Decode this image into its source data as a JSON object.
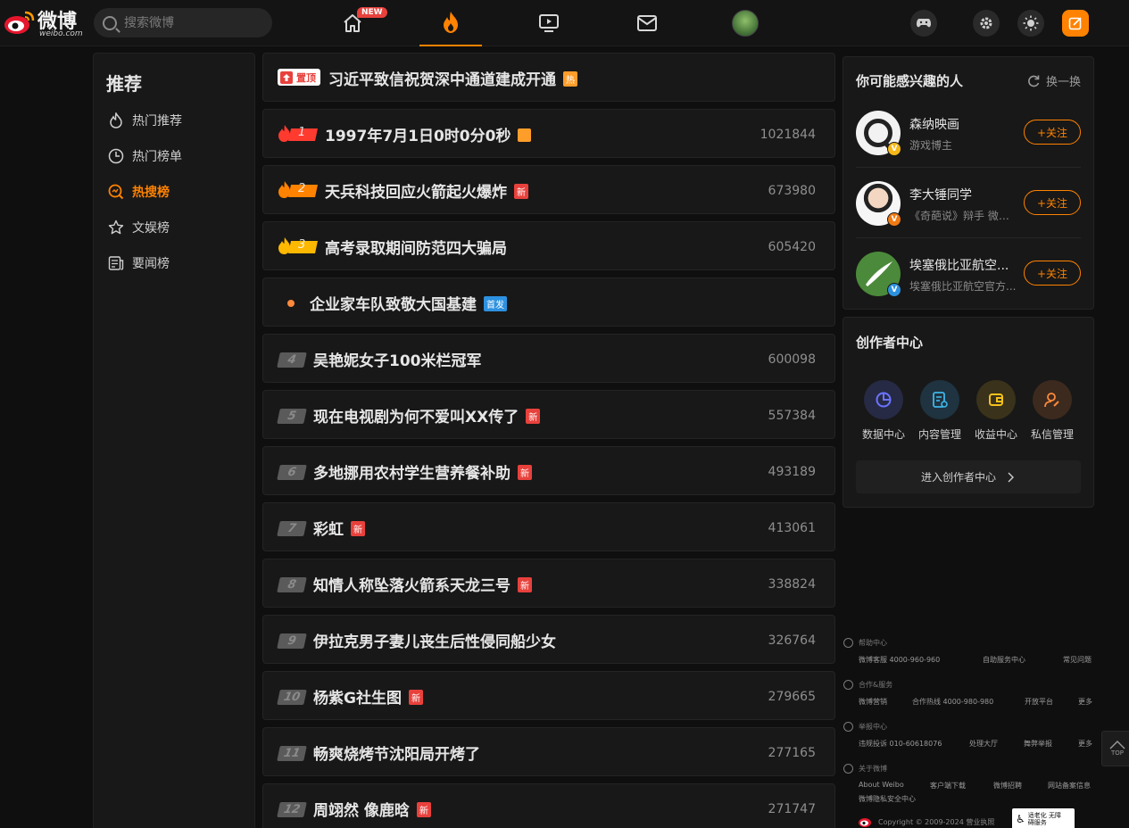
{
  "header": {
    "logo_text": "微博",
    "logo_sub": "weibo.com",
    "search_placeholder": "搜索微博",
    "new_badge": "NEW"
  },
  "sidebar": {
    "title": "推荐",
    "items": [
      {
        "label": "热门推荐",
        "icon": "flame-icon"
      },
      {
        "label": "热门榜单",
        "icon": "clock-icon"
      },
      {
        "label": "热搜榜",
        "icon": "search-trend-icon",
        "active": true
      },
      {
        "label": "文娱榜",
        "icon": "star-icon"
      },
      {
        "label": "要闻榜",
        "icon": "news-icon"
      }
    ]
  },
  "hot_list": {
    "pinned": {
      "pin_label": "置顶",
      "title": "习近平致信祝贺深中通道建成开通",
      "tag": "热"
    },
    "items": [
      {
        "rank": "1",
        "title": "1997年7月1日0时0分0秒",
        "tag": "",
        "tag_type": "hot-orange",
        "count": "1021844"
      },
      {
        "rank": "2",
        "title": "天兵科技回应火箭起火爆炸",
        "tag": "新",
        "tag_type": "new",
        "count": "673980"
      },
      {
        "rank": "3",
        "title": "高考录取期间防范四大骗局",
        "tag": "",
        "tag_type": "",
        "count": "605420"
      },
      {
        "rank": "",
        "title": "企业家车队致敬大国基建",
        "tag": "首发",
        "tag_type": "first",
        "count": ""
      },
      {
        "rank": "4",
        "title": "吴艳妮女子100米栏冠军",
        "tag": "",
        "tag_type": "",
        "count": "600098"
      },
      {
        "rank": "5",
        "title": "现在电视剧为何不爱叫XX传了",
        "tag": "新",
        "tag_type": "new",
        "count": "557384"
      },
      {
        "rank": "6",
        "title": "多地挪用农村学生营养餐补助",
        "tag": "新",
        "tag_type": "new",
        "count": "493189"
      },
      {
        "rank": "7",
        "title": "彩虹",
        "tag": "新",
        "tag_type": "new",
        "count": "413061"
      },
      {
        "rank": "8",
        "title": "知情人称坠落火箭系天龙三号",
        "tag": "新",
        "tag_type": "new",
        "count": "338824"
      },
      {
        "rank": "9",
        "title": "伊拉克男子妻儿丧生后性侵同船少女",
        "tag": "",
        "tag_type": "",
        "count": "326764"
      },
      {
        "rank": "10",
        "title": "杨紫G社生图",
        "tag": "新",
        "tag_type": "new",
        "count": "279665"
      },
      {
        "rank": "11",
        "title": "畅爽烧烤节沈阳局开烤了",
        "tag": "",
        "tag_type": "",
        "count": "277165"
      },
      {
        "rank": "12",
        "title": "周翊然 像鹿晗",
        "tag": "新",
        "tag_type": "new",
        "count": "271747"
      }
    ]
  },
  "suggest": {
    "title": "你可能感兴趣的人",
    "refresh_label": "换一换",
    "follow_label": "+关注",
    "people": [
      {
        "name": "森纳映画",
        "desc": "游戏博主",
        "badge": "V",
        "badge_color": "#f5b819"
      },
      {
        "name": "李大锤同学",
        "desc": "《奇葩说》辩手 微博...",
        "badge": "V",
        "badge_color": "#f07b14"
      },
      {
        "name": "埃塞俄比亚航空...",
        "desc": "埃塞俄比亚航空官方...",
        "badge": "V",
        "badge_color": "#2d91e0"
      }
    ]
  },
  "creator": {
    "title": "创作者中心",
    "items": [
      {
        "label": "数据中心",
        "icon": "pie-chart-icon",
        "color": "#6b74ff",
        "bg": "#262a44"
      },
      {
        "label": "内容管理",
        "icon": "document-edit-icon",
        "color": "#3fb6e8",
        "bg": "#1f3340"
      },
      {
        "label": "收益中心",
        "icon": "wallet-icon",
        "color": "#f5c11b",
        "bg": "#3a321a"
      },
      {
        "label": "私信管理",
        "icon": "user-edit-icon",
        "color": "#ff8a3c",
        "bg": "#3d2a1e"
      }
    ],
    "enter_label": "进入创作者中心"
  },
  "footer": {
    "sections": [
      {
        "head": "帮助中心",
        "links": [
          "微博客服 4000-960-960",
          "自助服务中心",
          "常见问题"
        ]
      },
      {
        "head": "合作&服务",
        "links": [
          "微博营销",
          "合作热线 4000-980-980",
          "开放平台",
          "更多"
        ]
      },
      {
        "head": "举报中心",
        "links": [
          "违规投诉 010-60618076",
          "处理大厅",
          "舞弊举报",
          "更多"
        ]
      },
      {
        "head": "关于微博",
        "links": [
          "About Weibo",
          "客户端下载",
          "微博招聘",
          "网站备案信息"
        ]
      }
    ],
    "privacy_link": "微博隐私安全中心",
    "copyright": "Copyright © 2009-2024 营业执照",
    "elder_badge": "适老化 无障碍服务"
  },
  "top_button": "TOP",
  "colors": {
    "accent": "#ff8200",
    "new_tag": "#e8413c",
    "first_tag": "#2d91e0"
  }
}
